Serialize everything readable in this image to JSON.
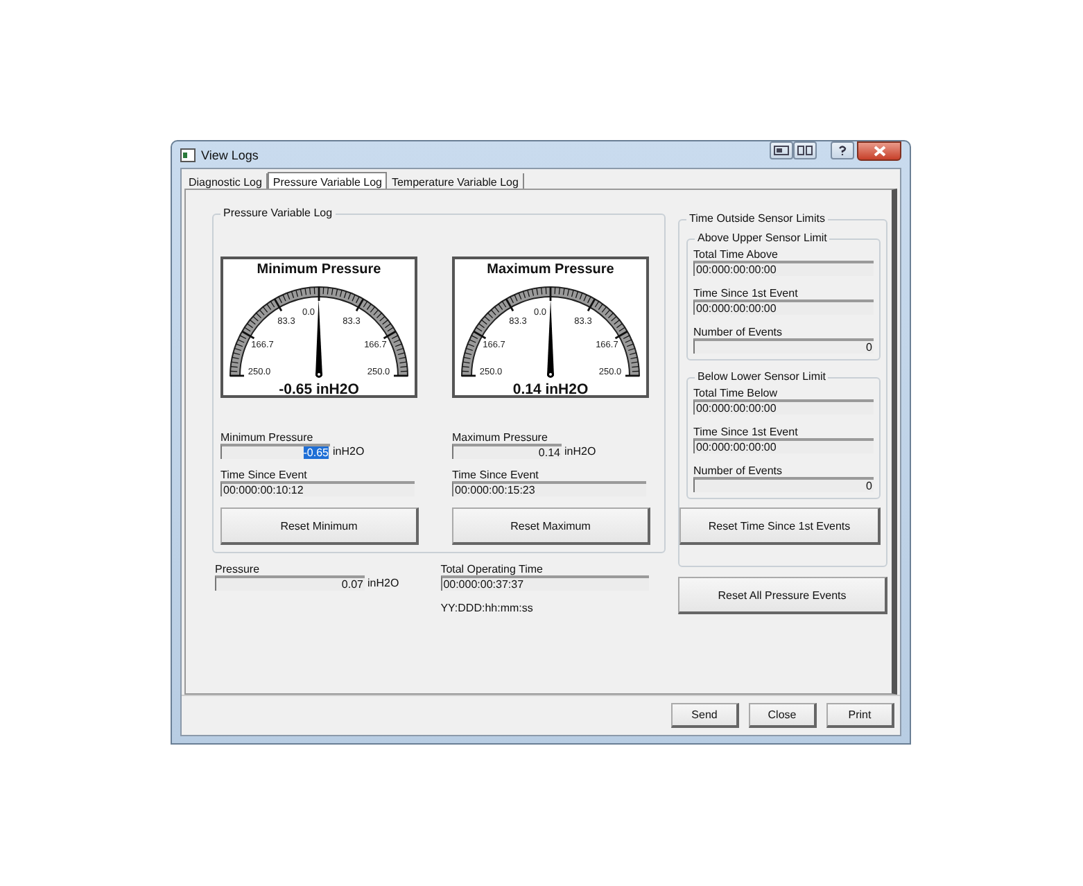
{
  "window": {
    "title": "View Logs"
  },
  "tabs": [
    {
      "label": "Diagnostic Log",
      "selected": false
    },
    {
      "label": "Pressure Variable Log",
      "selected": true
    },
    {
      "label": "Temperature Variable Log",
      "selected": false
    }
  ],
  "pressure_log": {
    "title": "Pressure Variable Log",
    "gauges": [
      {
        "title": "Minimum Pressure",
        "reading": "-0.65 inH2O",
        "level": 0.4987,
        "scale_labels": [
          "250.0",
          "166.7",
          "83.3",
          "0.0",
          "83.3",
          "166.7",
          "250.0"
        ]
      },
      {
        "title": "Maximum Pressure",
        "reading": "0.14 inH2O",
        "level": 0.5003,
        "scale_labels": [
          "250.0",
          "166.7",
          "83.3",
          "0.0",
          "83.3",
          "166.7",
          "250.0"
        ]
      }
    ],
    "readouts": [
      {
        "label": "Minimum Pressure",
        "value": "-0.65",
        "selected": true,
        "unit": "inH2O",
        "time_label": "Time Since Event",
        "time": "00:000:00:10:12",
        "button": "Reset Minimum"
      },
      {
        "label": "Maximum Pressure",
        "value": "0.14",
        "selected": false,
        "unit": "inH2O",
        "time_label": "Time Since Event",
        "time": "00:000:00:15:23",
        "button": "Reset Maximum"
      }
    ]
  },
  "pressure": {
    "label": "Pressure",
    "value": "0.07",
    "unit": "inH2O"
  },
  "total_operating_time": {
    "label": "Total Operating Time",
    "value": "00:000:00:37:37",
    "format": "YY:DDD:hh:mm:ss"
  },
  "sensor_limits": {
    "title": "Time Outside Sensor Limits",
    "groups": [
      {
        "title": "Above Upper Sensor Limit",
        "fields": [
          {
            "label": "Total Time Above",
            "value": "00:000:00:00:00",
            "kind": "time"
          },
          {
            "label": "Time Since 1st Event",
            "value": "00:000:00:00:00",
            "kind": "time"
          },
          {
            "label": "Number of Events",
            "value": "0",
            "kind": "count"
          }
        ]
      },
      {
        "title": "Below Lower Sensor Limit",
        "fields": [
          {
            "label": "Total Time Below",
            "value": "00:000:00:00:00",
            "kind": "time"
          },
          {
            "label": "Time Since 1st Event",
            "value": "00:000:00:00:00",
            "kind": "time"
          },
          {
            "label": "Number of Events",
            "value": "0",
            "kind": "count"
          }
        ]
      }
    ],
    "reset_button": "Reset Time Since 1st Events"
  },
  "reset_all_button": "Reset All Pressure Events",
  "footer_buttons": [
    "Send",
    "Close",
    "Print"
  ]
}
